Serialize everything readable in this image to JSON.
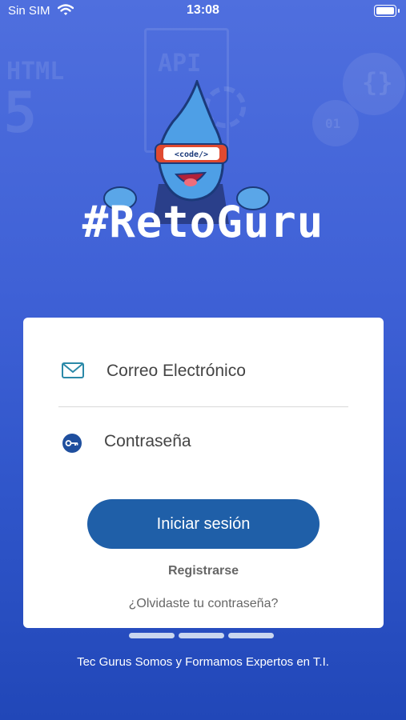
{
  "status_bar": {
    "carrier": "Sin SIM",
    "time": "13:08"
  },
  "background": {
    "deco_html": "HTML",
    "deco_five": "5",
    "deco_api": "API",
    "deco_braces": "{}",
    "deco_01": "01"
  },
  "mascot": {
    "visor_text": "<code/>"
  },
  "brand": {
    "title": "#RetoGuru"
  },
  "login_form": {
    "email_placeholder": "Correo Electrónico",
    "password_placeholder": "Contraseña",
    "login_button": "Iniciar sesión",
    "register_link": "Registrarse",
    "forgot_link": "¿Olvidaste tu contraseña?"
  },
  "pager": {
    "count": 3
  },
  "footer": {
    "tagline": "Tec Gurus Somos y Formamos Expertos en T.I."
  },
  "colors": {
    "primary_button": "#1f5fa8",
    "background_top": "#4f6fde",
    "background_bottom": "#2147b8"
  }
}
